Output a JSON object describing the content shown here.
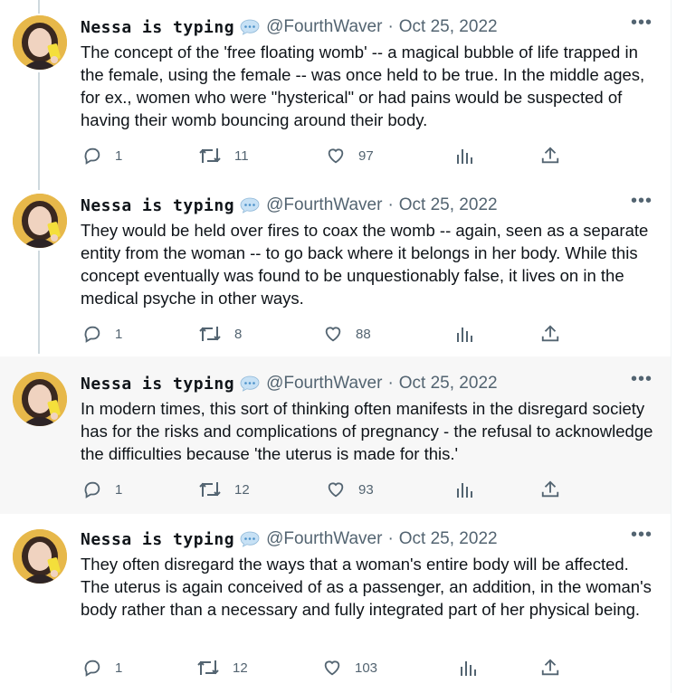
{
  "tweets": [
    {
      "name": "Nessa is typing",
      "handle": "@FourthWaver",
      "sep": "·",
      "date": "Oct 25, 2022",
      "text": "The concept of the 'free floating womb' -- a magical bubble of life trapped in the female, using the female -- was once held to be true. In the middle ages, for ex., women who were \"hysterical\" or had pains would be suspected of having their womb bouncing around their body.",
      "replies": "1",
      "retweets": "11",
      "likes": "97"
    },
    {
      "name": "Nessa is typing",
      "handle": "@FourthWaver",
      "sep": "·",
      "date": "Oct 25, 2022",
      "text": "They would be held over fires to coax the womb -- again, seen as a separate entity from the woman -- to go back where it belongs in her body. While this concept eventually was found to be unquestionably false, it lives on in the medical psyche in other ways.",
      "replies": "1",
      "retweets": "8",
      "likes": "88"
    },
    {
      "name": "Nessa is typing",
      "handle": "@FourthWaver",
      "sep": "·",
      "date": "Oct 25, 2022",
      "text": "In modern times, this sort of thinking often manifests in the disregard society has for the risks and complications of pregnancy - the refusal to acknowledge the difficulties because 'the uterus is made for this.'",
      "replies": "1",
      "retweets": "12",
      "likes": "93"
    },
    {
      "name": "Nessa is typing",
      "handle": "@FourthWaver",
      "sep": "·",
      "date": "Oct 25, 2022",
      "text": "They often disregard the ways that a woman's entire body will be affected. The uterus is again conceived of as a passenger, an addition, in the woman's body rather than a necessary and fully integrated part of her physical being.",
      "replies": "1",
      "retweets": "12",
      "likes": "103"
    }
  ],
  "icons": {
    "more": "more-horizontal-icon",
    "speech_bubble": "speech-bubble-emoji-icon",
    "reply": "reply-icon",
    "retweet": "retweet-icon",
    "like": "heart-icon",
    "views": "analytics-icon",
    "share": "share-icon"
  },
  "colors": {
    "muted": "#536471",
    "text": "#0f1419",
    "thread_line": "#cfd9de",
    "highlight_bg": "#f7f7f7",
    "avatar_bg": "#e7b84a"
  }
}
